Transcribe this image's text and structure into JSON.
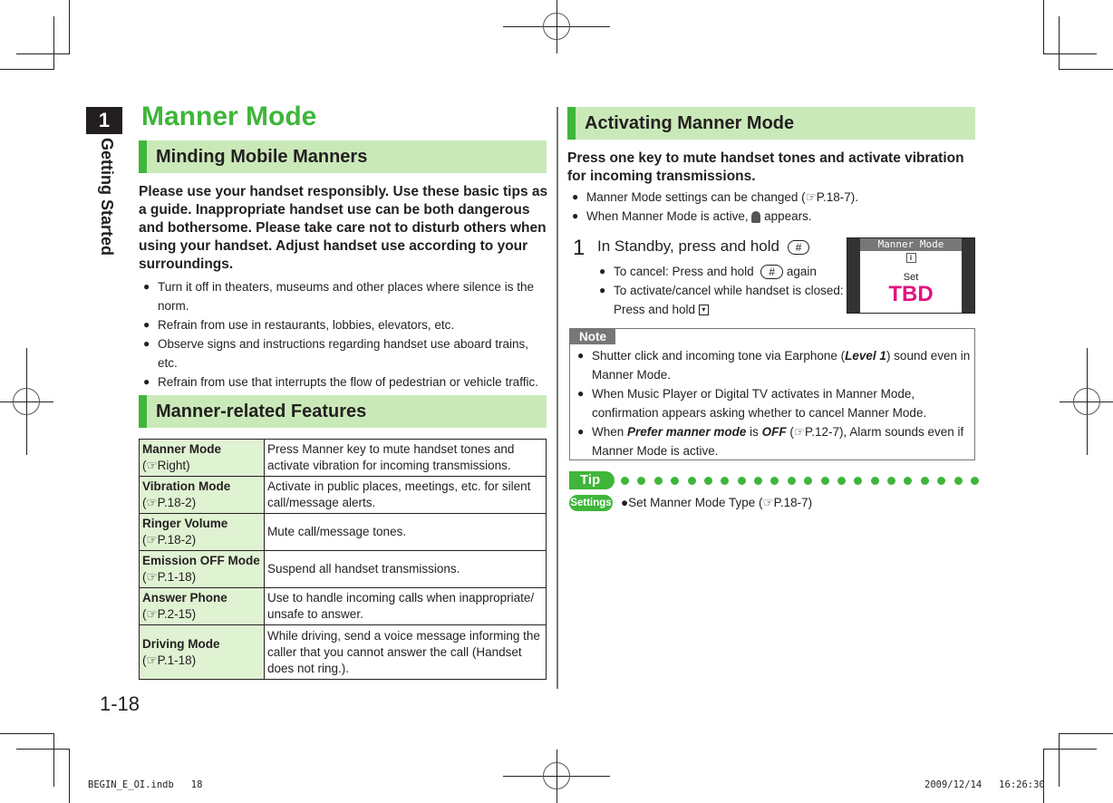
{
  "chapter": {
    "number": "1",
    "label": "Getting Started"
  },
  "page_title": "Manner Mode",
  "left": {
    "section1": {
      "heading": "Minding Mobile Manners",
      "lead": "Please use your handset responsibly. Use these basic tips as a guide. Inappropriate handset use can be both dangerous and bothersome. Please take care not to disturb others when using your handset. Adjust handset use according to your surroundings.",
      "bullets": [
        "Turn it off in theaters, museums and other places where silence is the norm.",
        "Refrain from use in restaurants, lobbies, elevators, etc.",
        "Observe signs and instructions regarding handset use aboard trains, etc.",
        "Refrain from use that interrupts the flow of pedestrian or vehicle traffic."
      ]
    },
    "section2": {
      "heading": "Manner-related Features",
      "features": [
        {
          "name": "Manner Mode",
          "ref": "(☞Right)",
          "desc": "Press Manner key to mute handset tones and activate vibration for incoming transmissions."
        },
        {
          "name": "Vibration Mode",
          "ref": "(☞P.18-2)",
          "desc": "Activate in public places, meetings, etc. for silent call/message alerts."
        },
        {
          "name": "Ringer Volume",
          "ref": "(☞P.18-2)",
          "desc": "Mute call/message tones."
        },
        {
          "name": "Emission OFF Mode",
          "ref": "(☞P.1-18)",
          "desc": "Suspend all handset transmissions."
        },
        {
          "name": "Answer Phone",
          "ref": "(☞P.2-15)",
          "desc": "Use to handle incoming calls when inappropriate/ unsafe to answer."
        },
        {
          "name": "Driving Mode",
          "ref": "(☞P.1-18)",
          "desc": "While driving, send a voice message informing the caller that you cannot answer the call (Handset does not ring.)."
        }
      ]
    }
  },
  "right": {
    "heading": "Activating Manner Mode",
    "lead": "Press one key to mute handset tones and activate vibration for incoming transmissions.",
    "bullets": {
      "b1": "Manner Mode settings can be changed (☞P.18-7).",
      "b2_pre": "When Manner Mode is active,",
      "b2_post": "appears."
    },
    "step": {
      "number": "1",
      "text": "In Standby, press and hold",
      "key": "#",
      "sub1_pre": "To cancel: Press and hold",
      "sub1_key": "#",
      "sub1_post": "again",
      "sub2_line1": "To activate/cancel while handset is closed:",
      "sub2_line2": "Press and hold",
      "sub2_key": "▾"
    },
    "screen": {
      "title": "Manner Mode",
      "info": "i",
      "set": "Set",
      "overlay": "TBD"
    },
    "note": {
      "label": "Note",
      "n1_pre": "Shutter click and incoming tone via Earphone (",
      "n1_bold": "Level 1",
      "n1_post": ") sound even in Manner Mode.",
      "n2": "When Music Player or Digital TV activates in Manner Mode, confirmation appears asking whether to cancel Manner Mode.",
      "n3_pre": "When ",
      "n3_bold1": "Prefer manner mode",
      "n3_mid": " is ",
      "n3_bold2": "OFF",
      "n3_post": " (☞P.12-7), Alarm sounds even if Manner Mode is active."
    },
    "tip": {
      "label": "Tip",
      "settings_label": "Settings",
      "settings_text": "●Set Manner Mode Type (☞P.18-7)"
    }
  },
  "footer": {
    "page_number": "1-18",
    "slug_left": "BEGIN_E_OI.indb   18",
    "slug_right": "2009/12/14   16:26:30"
  },
  "colors": {
    "accent_green": "#3fb63a",
    "heading_bg": "#cae9b8",
    "table_name_bg": "#dff2d2",
    "tbd_magenta": "#e2137f",
    "note_gray": "#777777"
  }
}
